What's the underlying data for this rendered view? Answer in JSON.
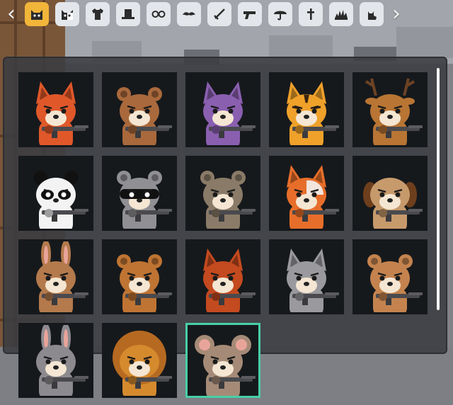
{
  "nav": {
    "prev_icon": "chevron-left-icon",
    "next_icon": "chevron-right-icon"
  },
  "categories": [
    {
      "icon": "cat-face-icon",
      "active": true
    },
    {
      "icon": "cat-face-alt-icon",
      "active": false
    },
    {
      "icon": "shirt-icon",
      "active": false
    },
    {
      "icon": "top-hat-icon",
      "active": false
    },
    {
      "icon": "glasses-icon",
      "active": false
    },
    {
      "icon": "mustache-icon",
      "active": false
    },
    {
      "icon": "sword-icon",
      "active": false
    },
    {
      "icon": "pistol-icon",
      "active": false
    },
    {
      "icon": "umbrella-icon",
      "active": false
    },
    {
      "icon": "gravestone-icon",
      "active": false
    },
    {
      "icon": "explosion-icon",
      "active": false
    },
    {
      "icon": "cat-pose-icon",
      "active": false
    }
  ],
  "characters": [
    {
      "animal": "fox",
      "color": "#e0582a"
    },
    {
      "animal": "bear",
      "color": "#a9693c"
    },
    {
      "animal": "wolf",
      "color": "#8a5fb0"
    },
    {
      "animal": "tiger",
      "color": "#efa12a"
    },
    {
      "animal": "deer",
      "color": "#b87534"
    },
    {
      "animal": "panda",
      "color": "#f3f3f3"
    },
    {
      "animal": "raccoon",
      "color": "#8f8f94"
    },
    {
      "animal": "sloth",
      "color": "#8a7b68"
    },
    {
      "animal": "calico-cat",
      "color": "#e76e2a"
    },
    {
      "animal": "beagle",
      "color": "#c79a6c"
    },
    {
      "animal": "bunny",
      "color": "#b47a4c"
    },
    {
      "animal": "monkey",
      "color": "#bf7433"
    },
    {
      "animal": "red-panda",
      "color": "#c44a1f"
    },
    {
      "animal": "husky",
      "color": "#9a9a9e"
    },
    {
      "animal": "capybara",
      "color": "#c4834e"
    },
    {
      "animal": "donkey",
      "color": "#8d8a8f"
    },
    {
      "animal": "lion",
      "color": "#d58a2e"
    },
    {
      "animal": "mouse",
      "color": "#a58b77"
    }
  ],
  "selected_index": 17,
  "colors": {
    "accent_active_tab": "#f1b53a",
    "selection": "#47cfa6",
    "card_bg": "#16191c"
  }
}
